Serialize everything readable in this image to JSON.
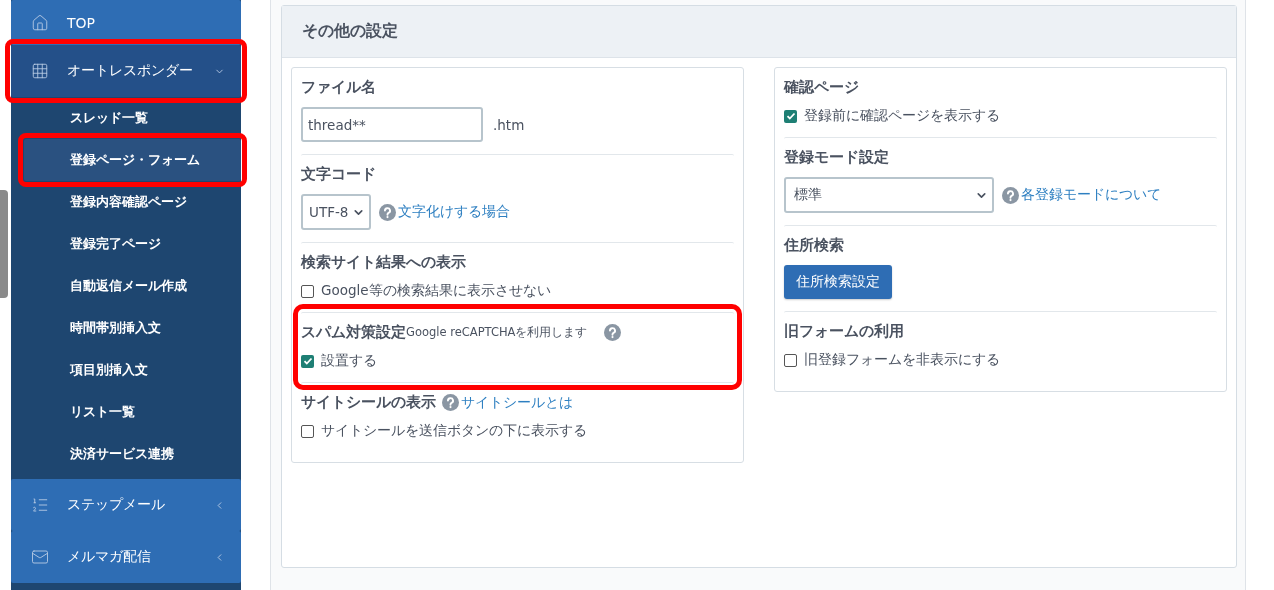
{
  "sidebar": {
    "items": [
      {
        "kind": "link",
        "label": "TOP",
        "selected": false,
        "highlighted": false
      },
      {
        "kind": "group",
        "label": "オートレスポンダー",
        "selected": true,
        "expanded": true,
        "highlighted": true,
        "children": [
          {
            "label": "スレッド一覧",
            "selected": false,
            "highlighted": false
          },
          {
            "label": "登録ページ・フォーム",
            "selected": true,
            "highlighted": true
          },
          {
            "label": "登録内容確認ページ",
            "selected": false,
            "highlighted": false
          },
          {
            "label": "登録完了ページ",
            "selected": false,
            "highlighted": false
          },
          {
            "label": "自動返信メール作成",
            "selected": false,
            "highlighted": false
          },
          {
            "label": "時間帯別挿入文",
            "selected": false,
            "highlighted": false
          },
          {
            "label": "項目別挿入文",
            "selected": false,
            "highlighted": false
          },
          {
            "label": "リスト一覧",
            "selected": false,
            "highlighted": false
          },
          {
            "label": "決済サービス連携",
            "selected": false,
            "highlighted": false
          }
        ]
      },
      {
        "kind": "group",
        "label": "ステップメール",
        "selected": false,
        "expanded": false,
        "highlighted": false
      },
      {
        "kind": "group",
        "label": "メルマガ配信",
        "selected": false,
        "expanded": false,
        "highlighted": false
      }
    ]
  },
  "panel": {
    "title": "その他の設定",
    "columns": [
      {
        "sections": [
          {
            "kind": "text_input",
            "heading": "ファイル名",
            "value": "thread**",
            "suffix": ".htm"
          },
          {
            "kind": "select",
            "heading": "文字コード",
            "value": "UTF-8",
            "help_link": "文字化けする場合"
          },
          {
            "kind": "checkbox",
            "heading": "検索サイト結果への表示",
            "checkbox": {
              "label": "Google等の検索結果に表示させない",
              "checked": false
            }
          },
          {
            "kind": "checkbox",
            "heading": "スパム対策設定",
            "note": "Google reCAPTCHAを利用します",
            "help_icon": true,
            "checkbox": {
              "label": "設置する",
              "checked": true
            },
            "highlighted": true
          },
          {
            "kind": "checkbox",
            "heading": "サイトシールの表示",
            "help_link": "サイトシールとは",
            "checkbox": {
              "label": "サイトシールを送信ボタンの下に表示する",
              "checked": false
            }
          }
        ]
      },
      {
        "sections": [
          {
            "kind": "checkbox",
            "heading": "確認ページ",
            "checkbox": {
              "label": "登録前に確認ページを表示する",
              "checked": true
            }
          },
          {
            "kind": "select",
            "heading": "登録モード設定",
            "value": "標準",
            "help_link": "各登録モードについて"
          },
          {
            "kind": "button",
            "heading": "住所検索",
            "button": "住所検索設定"
          },
          {
            "kind": "checkbox",
            "heading": "旧フォームの利用",
            "checkbox": {
              "label": "旧登録フォームを非表示にする",
              "checked": false
            }
          }
        ]
      }
    ]
  }
}
